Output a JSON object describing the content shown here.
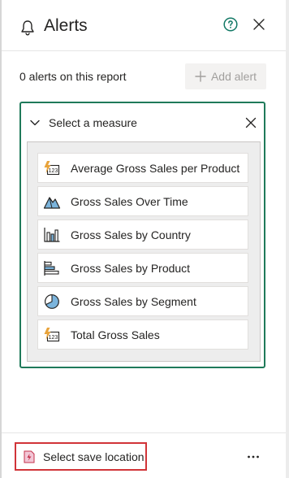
{
  "header": {
    "title": "Alerts",
    "icons": {
      "bell": "bell-icon",
      "help": "help-circle-icon",
      "close": "close-icon"
    }
  },
  "summary": {
    "count_text": "0 alerts on this report",
    "add_label": "Add alert"
  },
  "measure_picker": {
    "title": "Select a measure",
    "items": [
      {
        "label": "Average Gross Sales per Product",
        "icon": "card-visual-icon"
      },
      {
        "label": "Gross Sales Over Time",
        "icon": "area-chart-icon"
      },
      {
        "label": "Gross Sales by Country",
        "icon": "column-chart-icon"
      },
      {
        "label": "Gross Sales by Product",
        "icon": "bar-chart-icon"
      },
      {
        "label": "Gross Sales by Segment",
        "icon": "pie-chart-icon"
      },
      {
        "label": "Total Gross Sales",
        "icon": "card-visual-icon"
      }
    ]
  },
  "footer": {
    "save_label": "Select save location",
    "more_icon": "more-icon"
  },
  "colors": {
    "accent_border": "#1f7a5a",
    "help_icon": "#117865",
    "highlight_border": "#d13438",
    "card_icon_accent": "#e8a33b"
  }
}
